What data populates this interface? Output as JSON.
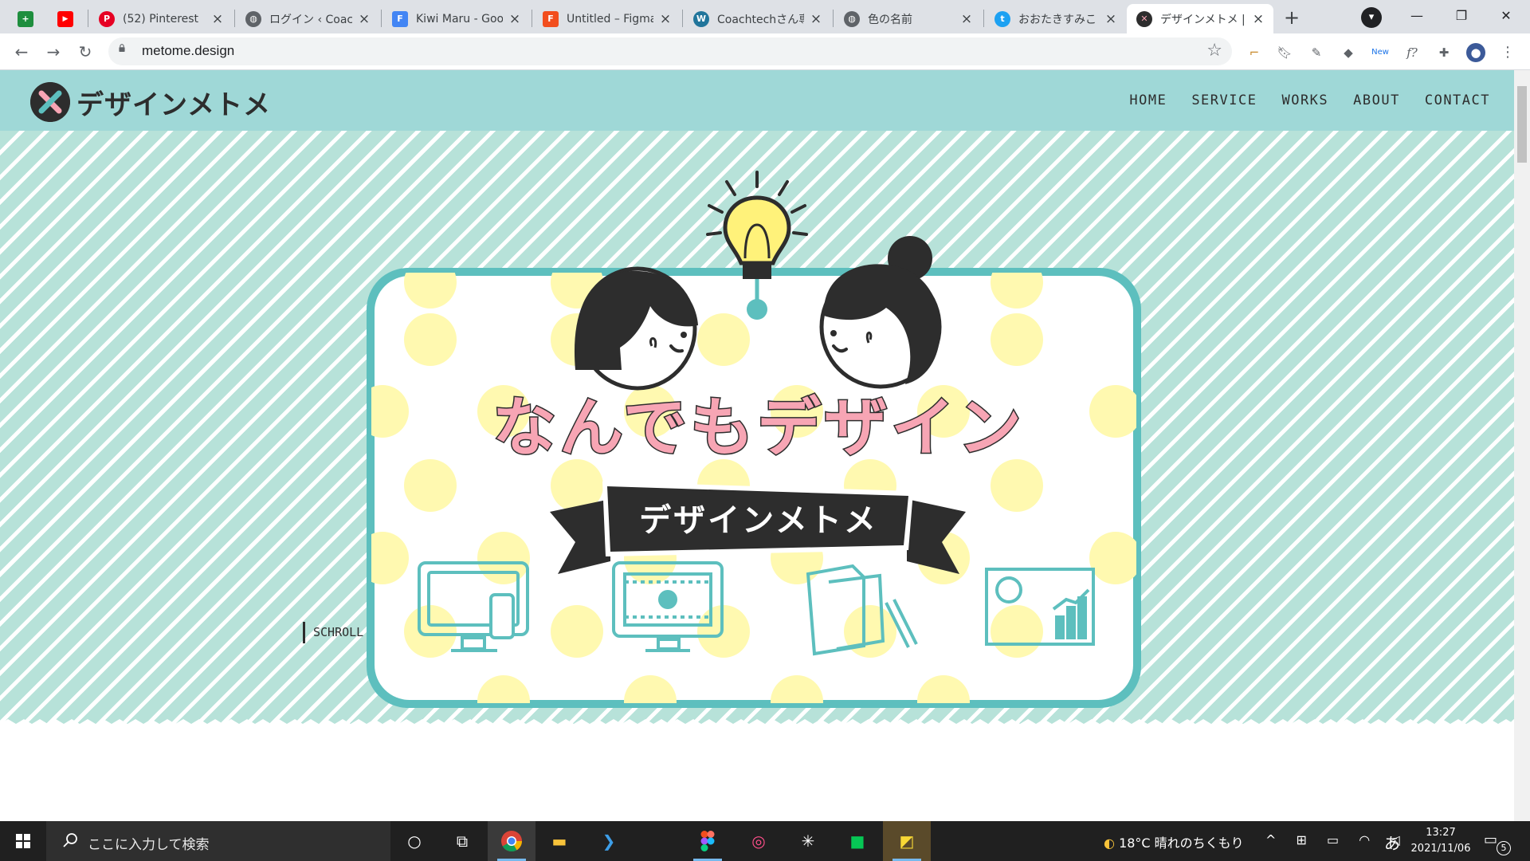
{
  "browser": {
    "tabs": [
      {
        "title": "",
        "favicon": "sheets-icon",
        "color": "#1e8e3e"
      },
      {
        "title": "",
        "favicon": "youtube-icon",
        "color": "#ff0000"
      },
      {
        "title": "(52) Pinterest",
        "favicon": "pinterest-icon",
        "color": "#e60023"
      },
      {
        "title": "ログイン ‹ Coachte",
        "favicon": "globe-icon",
        "color": "#5f6368"
      },
      {
        "title": "Kiwi Maru - Goo",
        "favicon": "google-fonts-icon",
        "color": "#4285f4"
      },
      {
        "title": "Untitled – Figma",
        "favicon": "figma-icon",
        "color": "#f24e1e"
      },
      {
        "title": "Coachtechさん専",
        "favicon": "wordpress-icon",
        "color": "#21759b"
      },
      {
        "title": "色の名前",
        "favicon": "globe-icon",
        "color": "#5f6368"
      },
      {
        "title": "おおたきすみこ | ス",
        "favicon": "twitter-icon",
        "color": "#1da1f2"
      },
      {
        "title": "デザインメトメ | な",
        "favicon": "metome-icon",
        "color": "#2d2d2d"
      }
    ],
    "new_tab": "+",
    "url": "metome.design",
    "window_controls": {
      "minimize": "—",
      "restore": "❐",
      "close": "✕"
    }
  },
  "site": {
    "logo_text": "デザインメトメ",
    "nav": [
      "HOME",
      "SERVICE",
      "WORKS",
      "ABOUT",
      "CONTACT"
    ],
    "hero": {
      "headline": "なんでもデザイン",
      "ribbon": "デザインメトメ",
      "scroll": "SCHROLL"
    },
    "colors": {
      "header": "#9fd8d7",
      "stripe": "#b7e2d9",
      "frame": "#5dbfbe",
      "dots": "#fff9b0",
      "headline_pink": "#f7a5b4",
      "ink": "#2d2d2d"
    }
  },
  "taskbar": {
    "search_placeholder": "ここに入力して検索",
    "weather": "18°C  晴れのちくもり",
    "ime": "あ",
    "time": "13:27",
    "date": "2021/11/06",
    "notifications": "5"
  }
}
